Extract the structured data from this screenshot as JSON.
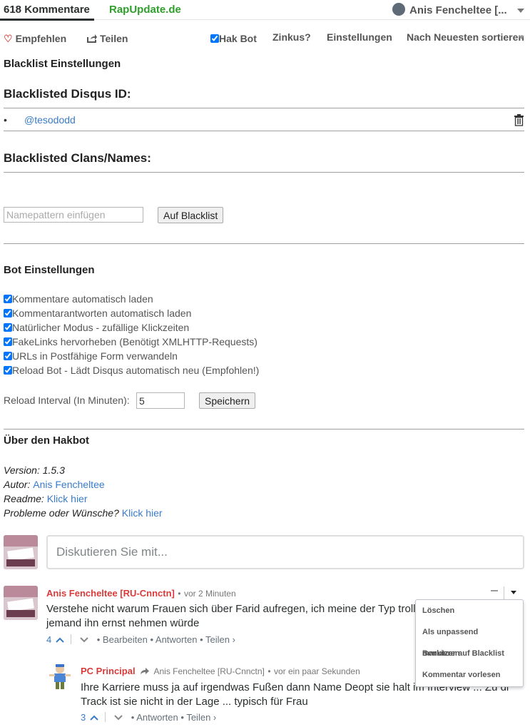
{
  "topbar": {
    "count_label": "618 Kommentare",
    "site_name": "RapUpdate.de",
    "user_name": "Anis Fencheltee [...",
    "user_dropdown_icon": "chevron-down-icon"
  },
  "toolbar": {
    "recommend_label": "Empfehlen",
    "share_label": "Teilen",
    "hakbot_label": "Hak Bot",
    "hakbot_checked": true,
    "zinkus_label": "Zinkus?",
    "settings_label": "Einstellungen",
    "sort_label": "Nach Neuesten sortieren"
  },
  "blacklist": {
    "title": "Blacklist Einstellungen",
    "ids_heading": "Blacklisted Disqus ID:",
    "ids": [
      "@tesododd"
    ],
    "names_heading": "Blacklisted Clans/Names:",
    "name_placeholder": "Namepattern einfügen",
    "add_button": "Auf Blacklist"
  },
  "bot": {
    "title": "Bot Einstellungen",
    "options": [
      {
        "label": "Kommentare automatisch laden",
        "checked": true
      },
      {
        "label": "Kommentarantworten automatisch laden",
        "checked": true
      },
      {
        "label": "Natürlicher Modus - zufällige Klickzeiten",
        "checked": true
      },
      {
        "label": "FakeLinks hervorheben (Benötigt XMLHTTP-Requests)",
        "checked": true
      },
      {
        "label": "URLs in Postfähige Form verwandeln",
        "checked": true
      },
      {
        "label": "Reload Bot - Lädt Disqus automatisch neu (Empfohlen!)",
        "checked": true
      }
    ],
    "interval_label": "Reload Interval (In Minuten):",
    "interval_value": "5",
    "save_button": "Speichern"
  },
  "about": {
    "title": "Über den Hakbot",
    "version_label": "Version: 1.5.3",
    "author_label": "Autor:",
    "author_link": "Anis Fencheltee",
    "readme_label": "Readme:",
    "readme_link": "Klick hier",
    "issues_label": "Probleme oder Wünsche?",
    "issues_link": "Klick hier"
  },
  "composer": {
    "placeholder": "Diskutieren Sie mit..."
  },
  "comments": [
    {
      "author": "Anis Fencheltee [RU-Cnnctn]",
      "time": "vor 2 Minuten",
      "text": "Verstehe nicht warum Frauen sich über Farid aufregen, ich meine der Typ trollt d",
      "text2": "jemand ihn ernst nehmen würde",
      "votes": "4",
      "edit": "Bearbeiten",
      "reply": "Antworten",
      "share": "Teilen ›",
      "sep": "•"
    },
    {
      "author": "PC Principal",
      "reply_to": "Anis Fencheltee [RU-Cnnctn]",
      "time": "vor ein paar Sekunden",
      "text": "Ihre Karriere muss ja auf irgendwas Fußen dann Name Deopt sie halt im Interview ... Zu diss",
      "text2": "Track ist sie nicht in der Lage ... typisch für Frau",
      "votes": "3",
      "reply": "Antworten",
      "share": "Teilen ›",
      "sep": "•"
    }
  ],
  "menu": {
    "items": [
      "Löschen",
      "Als unpassend markieren",
      "Benutzer auf Blacklist",
      "Kommentar vorlesen"
    ]
  },
  "colors": {
    "site": "#2e9f2a",
    "author": "#d93b3b",
    "link": "#3a7bc8"
  }
}
